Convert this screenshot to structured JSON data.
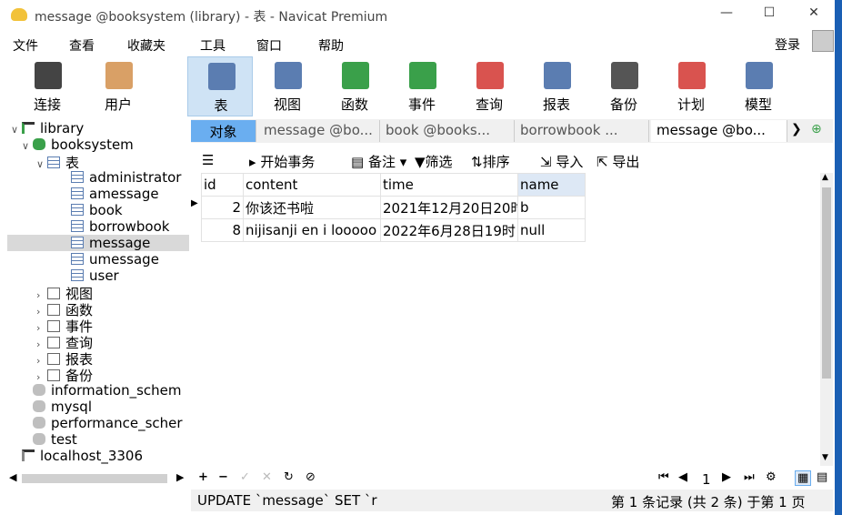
{
  "window": {
    "title": "message @booksystem (library) - 表 - Navicat Premium"
  },
  "menu": [
    "文件",
    "查看",
    "收藏夹",
    "工具",
    "窗口",
    "帮助"
  ],
  "login": "登录",
  "toolbar": [
    {
      "label": "连接",
      "icon": "plug-icon",
      "color": "#444444"
    },
    {
      "label": "用户",
      "icon": "user-icon",
      "color": "#d9a066"
    },
    {
      "label": "表",
      "icon": "table-icon",
      "color": "#5b7db1"
    },
    {
      "label": "视图",
      "icon": "view-icon",
      "color": "#5b7db1"
    },
    {
      "label": "函数",
      "icon": "function-icon",
      "color": "#3aa04a"
    },
    {
      "label": "事件",
      "icon": "event-icon",
      "color": "#3aa04a"
    },
    {
      "label": "查询",
      "icon": "query-icon",
      "color": "#d9534f"
    },
    {
      "label": "报表",
      "icon": "report-icon",
      "color": "#5b7db1"
    },
    {
      "label": "备份",
      "icon": "backup-icon",
      "color": "#555555"
    },
    {
      "label": "计划",
      "icon": "schedule-icon",
      "color": "#d9534f"
    },
    {
      "label": "模型",
      "icon": "model-icon",
      "color": "#5b7db1"
    }
  ],
  "tree": [
    {
      "label": "library",
      "icon": "connection-icon"
    },
    {
      "label": "booksystem",
      "icon": "db-icon"
    },
    {
      "label": "表",
      "icon": "table-folder-icon"
    },
    {
      "label": "administrator",
      "icon": "table-icon"
    },
    {
      "label": "amessage",
      "icon": "table-icon"
    },
    {
      "label": "book",
      "icon": "table-icon"
    },
    {
      "label": "borrowbook",
      "icon": "table-icon"
    },
    {
      "label": "message",
      "icon": "table-icon"
    },
    {
      "label": "umessage",
      "icon": "table-icon"
    },
    {
      "label": "user",
      "icon": "table-icon"
    },
    {
      "label": "视图",
      "icon": "view-icon"
    },
    {
      "label": "函数",
      "icon": "function-icon"
    },
    {
      "label": "事件",
      "icon": "event-icon"
    },
    {
      "label": "查询",
      "icon": "query-icon"
    },
    {
      "label": "报表",
      "icon": "report-icon"
    },
    {
      "label": "备份",
      "icon": "backup-icon"
    },
    {
      "label": "information_schem",
      "icon": "db-icon"
    },
    {
      "label": "mysql",
      "icon": "db-icon"
    },
    {
      "label": "performance_scher",
      "icon": "db-icon"
    },
    {
      "label": "test",
      "icon": "db-icon"
    },
    {
      "label": "localhost_3306",
      "icon": "connection-icon"
    }
  ],
  "tabs": {
    "object": "对象",
    "items": [
      "message @bo...",
      "book @books...",
      "borrowbook ...",
      "message @bo..."
    ]
  },
  "subtoolbar": {
    "begin": "开始事务",
    "note": "备注",
    "filter": "筛选",
    "sort": "排序",
    "import": "导入",
    "export": "导出"
  },
  "grid": {
    "columns": [
      "id",
      "content",
      "time",
      "name"
    ],
    "rows": [
      [
        "2",
        "你该还书啦",
        "2021年12月20日20时",
        "b"
      ],
      [
        "8",
        "nijisanji en i looooo",
        "2022年6月28日19时",
        "null"
      ]
    ]
  },
  "pager": {
    "page": "1"
  },
  "status": {
    "sql": "UPDATE `message` SET `r",
    "records": "第 1 条记录 (共 2 条) 于第 1 页"
  }
}
